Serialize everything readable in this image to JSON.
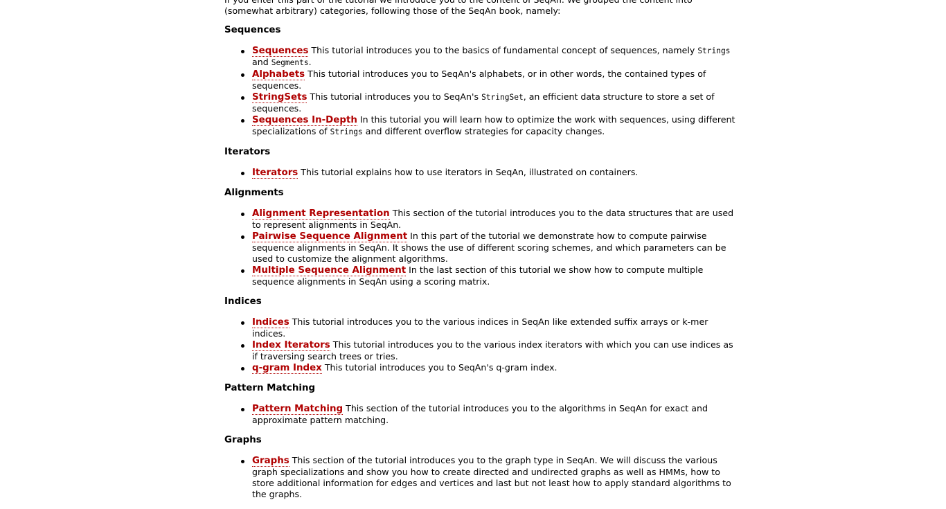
{
  "intro": {
    "text": "If you enter this part of the tutorial we introduce you to the content of SeqAn. We grouped the content into (somewhat arbitrary) categories, following those of the SeqAn book, namely:"
  },
  "sections": [
    {
      "title": "Sequences",
      "items": [
        {
          "link": "Sequences",
          "parts": [
            " This tutorial introduces you to the basics of fundamental concept of sequences, namely ",
            {
              "code": "Strings"
            },
            " and ",
            {
              "code": "Segments"
            },
            "."
          ]
        },
        {
          "link": "Alphabets",
          "parts": [
            " This tutorial introduces you to SeqAn's alphabets, or in other words, the contained types of sequences."
          ]
        },
        {
          "link": "StringSets",
          "parts": [
            " This tutorial introduces you to SeqAn's ",
            {
              "code": "StringSet"
            },
            ", an efficient data structure to store a set of sequences."
          ]
        },
        {
          "link": "Sequences In-Depth",
          "parts": [
            " In this tutorial you will learn how to optimize the work with sequences, using different specializations of ",
            {
              "code": "Strings"
            },
            " and different overflow strategies for capacity changes."
          ]
        }
      ]
    },
    {
      "title": "Iterators",
      "items": [
        {
          "link": "Iterators",
          "parts": [
            " This tutorial explains how to use iterators in SeqAn, illustrated on containers."
          ]
        }
      ]
    },
    {
      "title": "Alignments",
      "items": [
        {
          "link": "Alignment Representation",
          "parts": [
            " This section of the tutorial introduces you to the data structures that are used to represent alignments in SeqAn."
          ]
        },
        {
          "link": "Pairwise Sequence Alignment",
          "parts": [
            " In this part of the tutorial we demonstrate how to compute pairwise sequence alignments in SeqAn. It shows the use of different scoring schemes, and which parameters can be used to customize the alignment algorithms."
          ]
        },
        {
          "link": "Multiple Sequence Alignment",
          "parts": [
            " In the last section of this tutorial we show how to compute multiple sequence alignments in SeqAn using a scoring matrix."
          ]
        }
      ]
    },
    {
      "title": "Indices",
      "items": [
        {
          "link": "Indices",
          "parts": [
            " This tutorial introduces you to the various indices in SeqAn like extended suffix arrays or k-mer indices."
          ]
        },
        {
          "link": "Index Iterators",
          "parts": [
            " This tutorial introduces you to the various index iterators with which you can use indices as if traversing search trees or tries."
          ]
        },
        {
          "link": "q-gram Index",
          "parts": [
            " This tutorial introduces you to SeqAn's q-gram index."
          ]
        }
      ]
    },
    {
      "title": "Pattern Matching",
      "items": [
        {
          "link": "Pattern Matching",
          "parts": [
            " This section of the tutorial introduces you to the algorithms in SeqAn for exact and approximate pattern matching."
          ]
        }
      ]
    },
    {
      "title": "Graphs",
      "items": [
        {
          "link": "Graphs",
          "parts": [
            " This section of the tutorial introduces you to the graph type in SeqAn. We will discuss the various graph specializations and show you how to create directed and undirected graphs as well as HMMs, how to store additional information for edges and vertices and last but not least how to apply standard algorithms to the graphs."
          ]
        }
      ]
    }
  ],
  "colors": {
    "link": "#b00000",
    "text": "#000000",
    "background": "#ffffff"
  }
}
